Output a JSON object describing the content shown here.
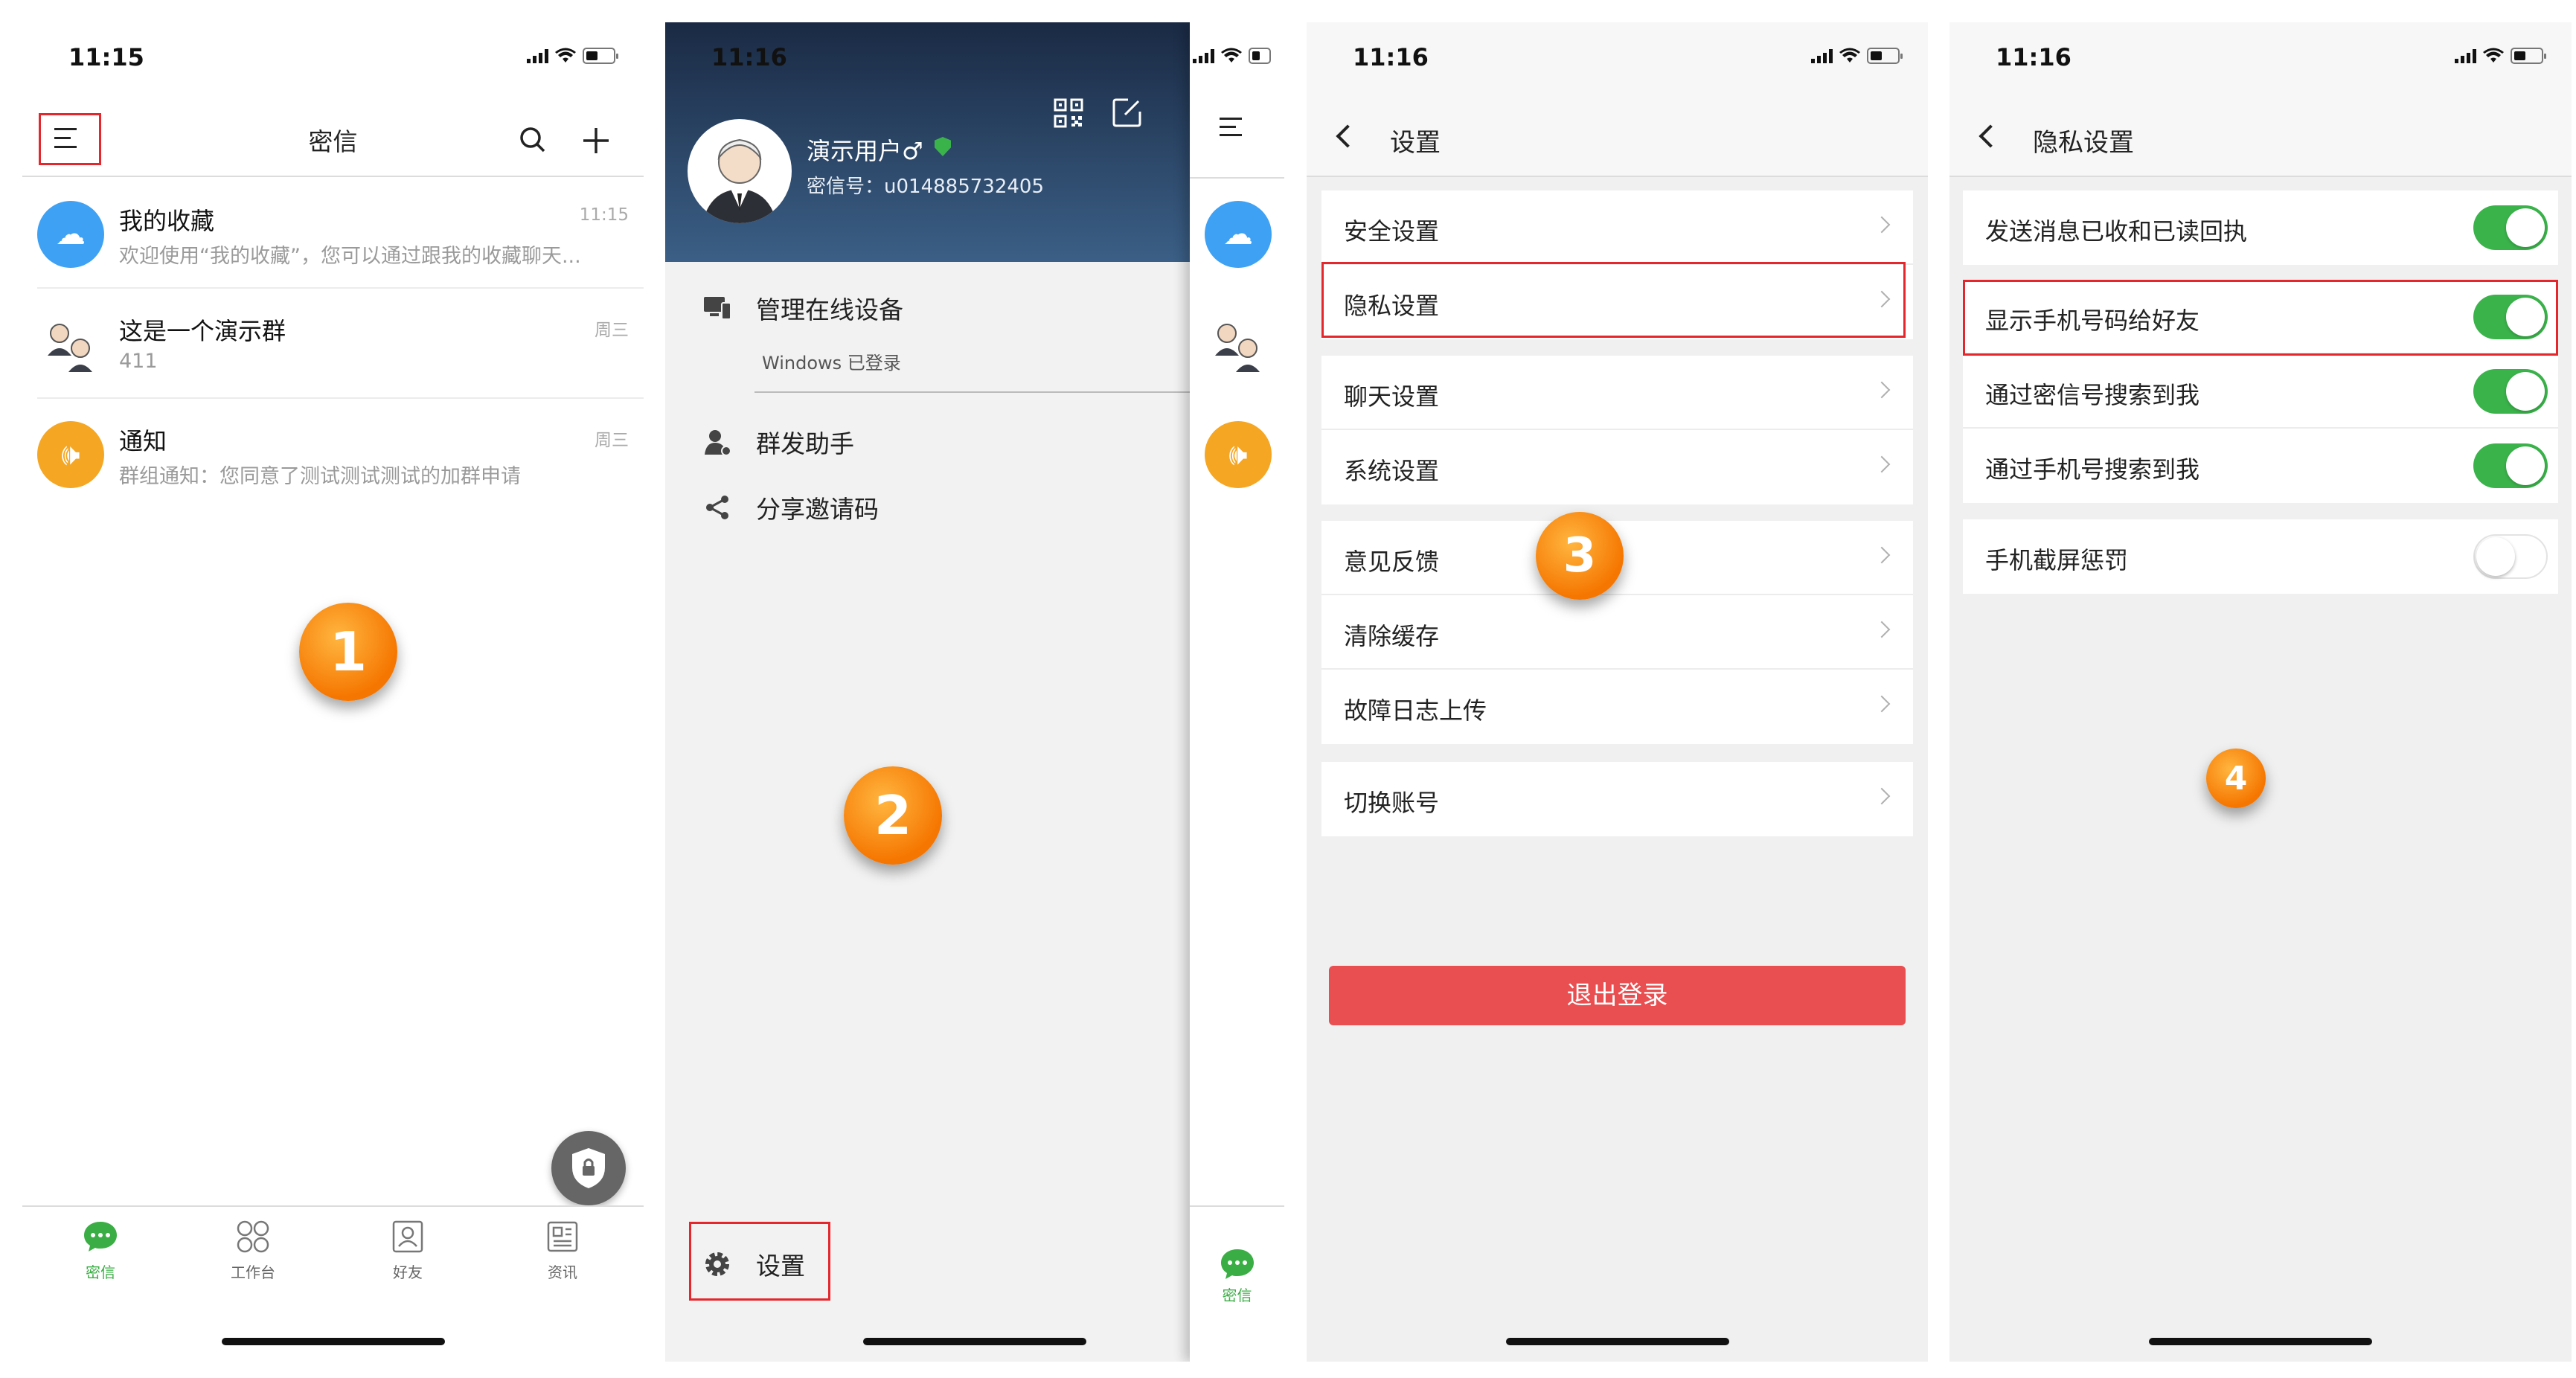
{
  "colors": {
    "accent_green": "#3bb34b",
    "logout_red": "#e94e50",
    "highlight_red": "#e4262d",
    "badge_orange": "#f57600"
  },
  "screen1": {
    "time": "11:15",
    "title": "密信",
    "chats": [
      {
        "title": "我的收藏",
        "subtitle": "欢迎使用“我的收藏”，您可以通过跟我的收藏聊天...",
        "time": "11:15",
        "icon": "cloud-lock-icon"
      },
      {
        "title": "这是一个演示群",
        "subtitle": "411",
        "time": "周三",
        "icon": "group-avatar-icon"
      },
      {
        "title": "通知",
        "subtitle": "群组通知：您同意了测试测试测试的加群申请",
        "time": "周三",
        "icon": "speaker-icon"
      }
    ],
    "tabs": [
      {
        "label": "密信",
        "icon": "chat-icon"
      },
      {
        "label": "工作台",
        "icon": "workbench-icon"
      },
      {
        "label": "好友",
        "icon": "contacts-icon"
      },
      {
        "label": "资讯",
        "icon": "news-icon"
      }
    ],
    "badge": "1"
  },
  "screen2": {
    "time": "11:16",
    "user_name": "演示用户♂",
    "user_id": "密信号：u014885732405",
    "items": [
      "管理在线设备",
      "Windows 已登录",
      "群发助手",
      "分享邀请码"
    ],
    "settings": "设置",
    "peek_tab": "密信",
    "badge": "2"
  },
  "screen3": {
    "time": "11:16",
    "title": "设置",
    "group1": [
      "安全设置",
      "隐私设置"
    ],
    "group2": [
      "聊天设置",
      "系统设置"
    ],
    "group3": [
      "意见反馈",
      "清除缓存",
      "故障日志上传"
    ],
    "group4": [
      "切换账号"
    ],
    "logout": "退出登录",
    "badge": "3"
  },
  "screen4": {
    "time": "11:16",
    "title": "隐私设置",
    "group1": [
      {
        "label": "发送消息已收和已读回执",
        "on": true
      }
    ],
    "group2": [
      {
        "label": "显示手机号码给好友",
        "on": true
      },
      {
        "label": "通过密信号搜索到我",
        "on": true
      },
      {
        "label": "通过手机号搜索到我",
        "on": true
      }
    ],
    "group3": [
      {
        "label": "手机截屏惩罚",
        "on": false
      }
    ],
    "badge": "4"
  }
}
